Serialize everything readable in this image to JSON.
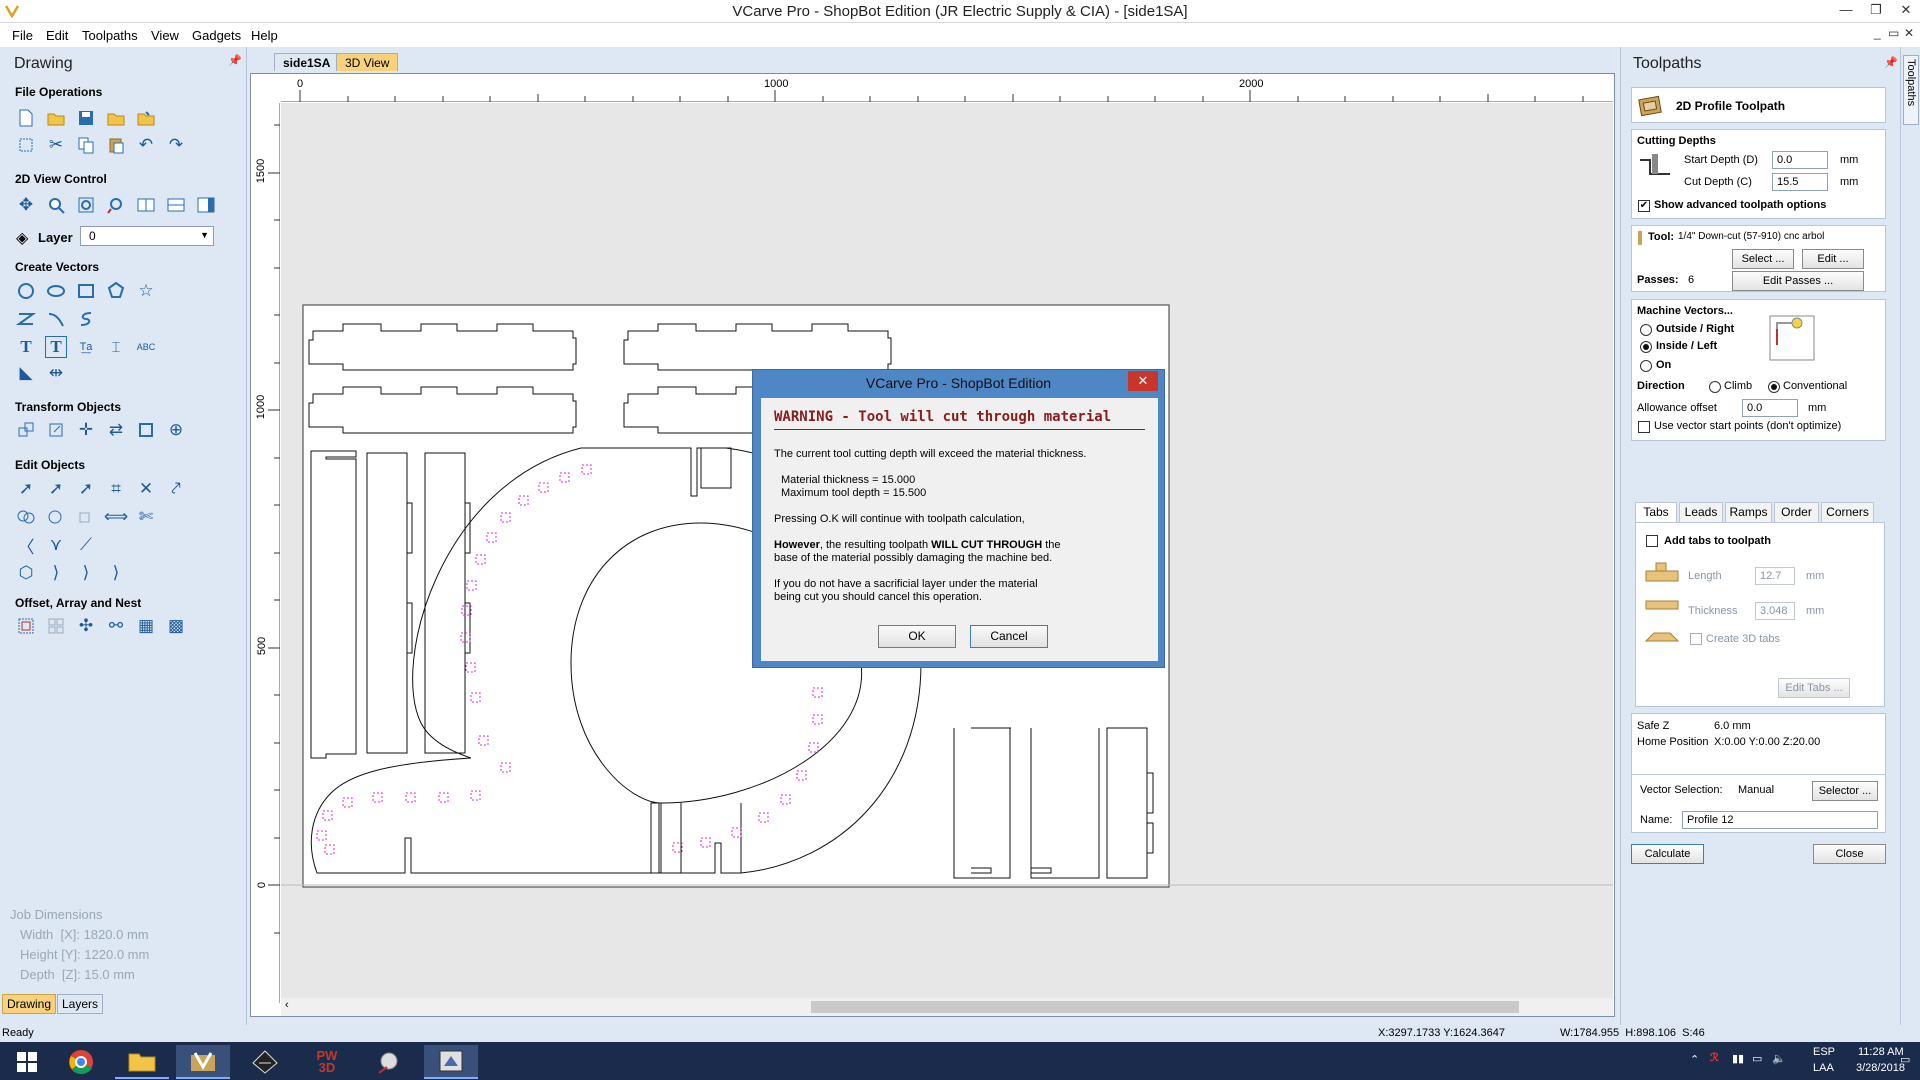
{
  "window": {
    "title": "VCarve Pro - ShopBot Edition (JR Electric Supply & CIA) - [side1SA]",
    "controls": {
      "minimize": "—",
      "restore": "❐",
      "close": "✕"
    },
    "mdi_controls": {
      "minimize": "_",
      "restore": "▭",
      "close": "✕"
    }
  },
  "menu": [
    "File",
    "Edit",
    "Toolpaths",
    "View",
    "Gadgets",
    "Help"
  ],
  "left_panel": {
    "title": "Drawing",
    "sections": {
      "file_operations": "File Operations",
      "view_control": "2D View Control",
      "create_vectors": "Create Vectors",
      "transform_objects": "Transform Objects",
      "edit_objects": "Edit Objects",
      "offset_array_nest": "Offset, Array and Nest"
    },
    "layer": {
      "label": "Layer",
      "value": "0"
    },
    "job_dimensions": {
      "title": "Job Dimensions",
      "width": "Width  [X]: 1820.0 mm",
      "height": "Height [Y]: 1220.0 mm",
      "depth": "Depth  [Z]: 15.0 mm"
    },
    "bottom_tabs": [
      "Drawing",
      "Layers"
    ]
  },
  "document": {
    "tabs": [
      "side1SA",
      "3D View"
    ],
    "ruler_h": [
      "0",
      "1000",
      "2000"
    ],
    "ruler_v": [
      "1500",
      "1000",
      "500",
      "0"
    ]
  },
  "dialog": {
    "title": "VCarve Pro - ShopBot Edition",
    "close": "✕",
    "heading": "WARNING - Tool will cut through material",
    "p1": "The current tool cutting depth will exceed the material thickness.",
    "thickness": "Material thickness = 15.000",
    "max_depth": "Maximum tool depth = 15.500",
    "p2": "Pressing O.K will continue with toolpath calculation,",
    "p3_bold1": "However",
    "p3_a": ", the resulting toolpath ",
    "p3_bold2": "WILL CUT THROUGH",
    "p3_b": " the",
    "p3_line2": "base of the material possibly damaging the machine bed.",
    "p4_line1": "If you do not have a sacrificial layer under the material",
    "p4_line2": "being cut you should cancel this operation.",
    "ok": "OK",
    "cancel": "Cancel"
  },
  "right_panel": {
    "title": "Toolpaths",
    "toolpath_name": "2D Profile Toolpath",
    "cutting_depths": {
      "title": "Cutting Depths",
      "start_label": "Start Depth (D)",
      "start_value": "0.0",
      "cut_label": "Cut Depth (C)",
      "cut_value": "15.5",
      "unit": "mm",
      "show_advanced": "Show advanced toolpath options"
    },
    "tool": {
      "label": "Tool:",
      "name": "1/4\" Down-cut (57-910) cnc arbol",
      "select": "Select ...",
      "edit": "Edit ...",
      "passes_label": "Passes:",
      "passes_value": "6",
      "edit_passes": "Edit Passes ..."
    },
    "machine_vectors": {
      "title": "Machine Vectors...",
      "outside": "Outside / Right",
      "inside": "Inside / Left",
      "on": "On",
      "direction": "Direction",
      "climb": "Climb",
      "conventional": "Conventional",
      "allowance_label": "Allowance offset",
      "allowance_value": "0.0",
      "unit": "mm",
      "start_points": "Use vector start points (don't optimize)"
    },
    "tabs": [
      "Tabs",
      "Leads",
      "Ramps",
      "Order",
      "Corners"
    ],
    "tabs_panel": {
      "add_tabs": "Add tabs to toolpath",
      "length_label": "Length",
      "length_value": "12.7",
      "thickness_label": "Thickness",
      "thickness_value": "3.048",
      "unit": "mm",
      "create_3d": "Create 3D tabs",
      "edit_tabs": "Edit Tabs ..."
    },
    "safe_z_label": "Safe Z",
    "safe_z_value": "6.0 mm",
    "home_label": "Home Position",
    "home_value": "X:0.00 Y:0.00 Z:20.00",
    "vector_selection_label": "Vector Selection:",
    "vector_selection_value": "Manual",
    "selector": "Selector ...",
    "name_label": "Name:",
    "name_value": "Profile 12",
    "calculate": "Calculate",
    "close": "Close",
    "side_tab": "Toolpaths"
  },
  "status": {
    "left": "Ready",
    "coords": "X:3297.1733 Y:1624.3647",
    "size": "W:1784.955  H:898.106  S:46"
  },
  "taskbar": {
    "lang1": "ESP",
    "lang2": "LAA",
    "time": "11:28 AM",
    "date": "3/28/2018"
  },
  "colors": {
    "panel_bg": "#dde8f4",
    "dialog_frame": "#4f86c6",
    "warning_red": "#8a1c1c",
    "tab_marker": "#e020e0",
    "taskbar": "#1a2b4c"
  }
}
